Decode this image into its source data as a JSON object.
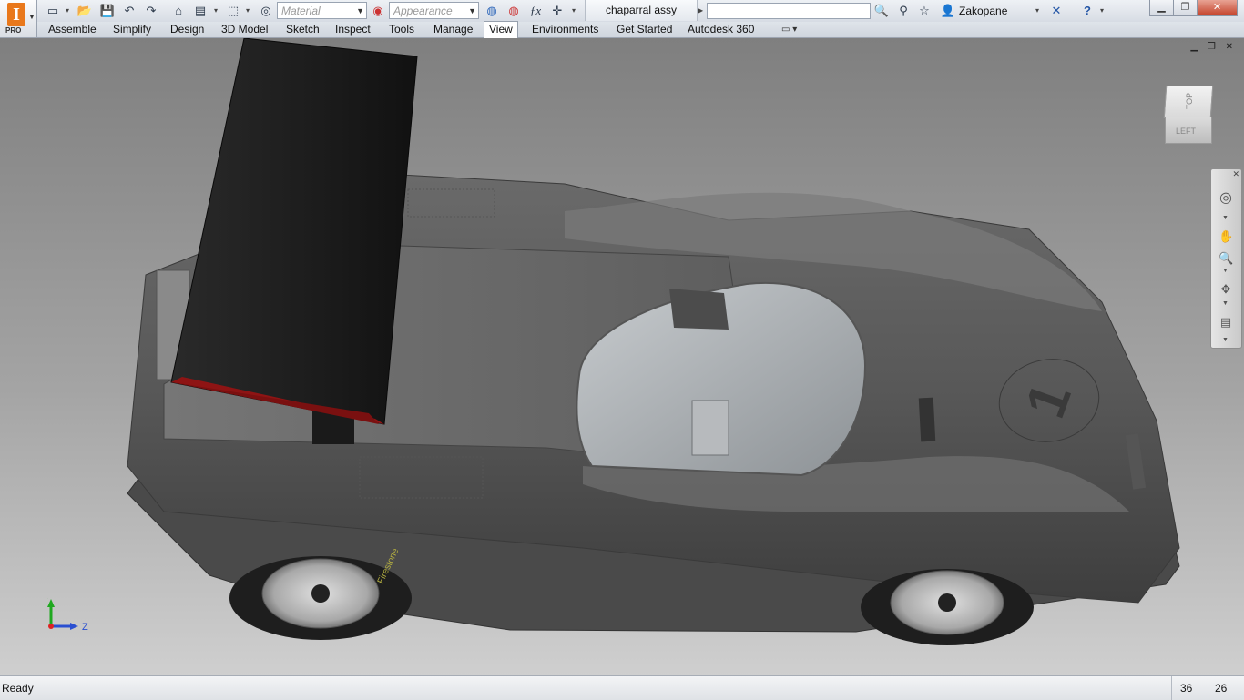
{
  "app": {
    "edition": "PRO",
    "document_title": "chaparral assy",
    "user": "Zakopane"
  },
  "quick_access": {
    "material_placeholder": "Material",
    "appearance_placeholder": "Appearance",
    "search_value": ""
  },
  "tabs": [
    {
      "label": "Assemble"
    },
    {
      "label": "Simplify"
    },
    {
      "label": "Design"
    },
    {
      "label": "3D Model"
    },
    {
      "label": "Sketch"
    },
    {
      "label": "Inspect"
    },
    {
      "label": "Tools"
    },
    {
      "label": "Manage"
    },
    {
      "label": "View",
      "active": true
    },
    {
      "label": "Environments"
    },
    {
      "label": "Get Started"
    },
    {
      "label": "Autodesk 360"
    }
  ],
  "viewcube": {
    "top_label": "TOP",
    "left_label": "LEFT"
  },
  "triad": {
    "y_label": "Y",
    "z_label": "Z"
  },
  "car": {
    "race_number": "1",
    "tire_text": "Firestone"
  },
  "status": {
    "text": "Ready",
    "count_a": "36",
    "count_b": "26"
  },
  "colors": {
    "accent": "#e9781b",
    "wing_underside": "#8e1414",
    "body": "#5a5a5a"
  },
  "icons": [
    "new-icon",
    "open-icon",
    "save-icon",
    "undo-icon",
    "redo-icon",
    "home-icon",
    "appearance-icon",
    "fx-icon",
    "search-icon",
    "binoculars-icon",
    "star-icon",
    "user-icon",
    "exchange-icon",
    "help-icon"
  ]
}
